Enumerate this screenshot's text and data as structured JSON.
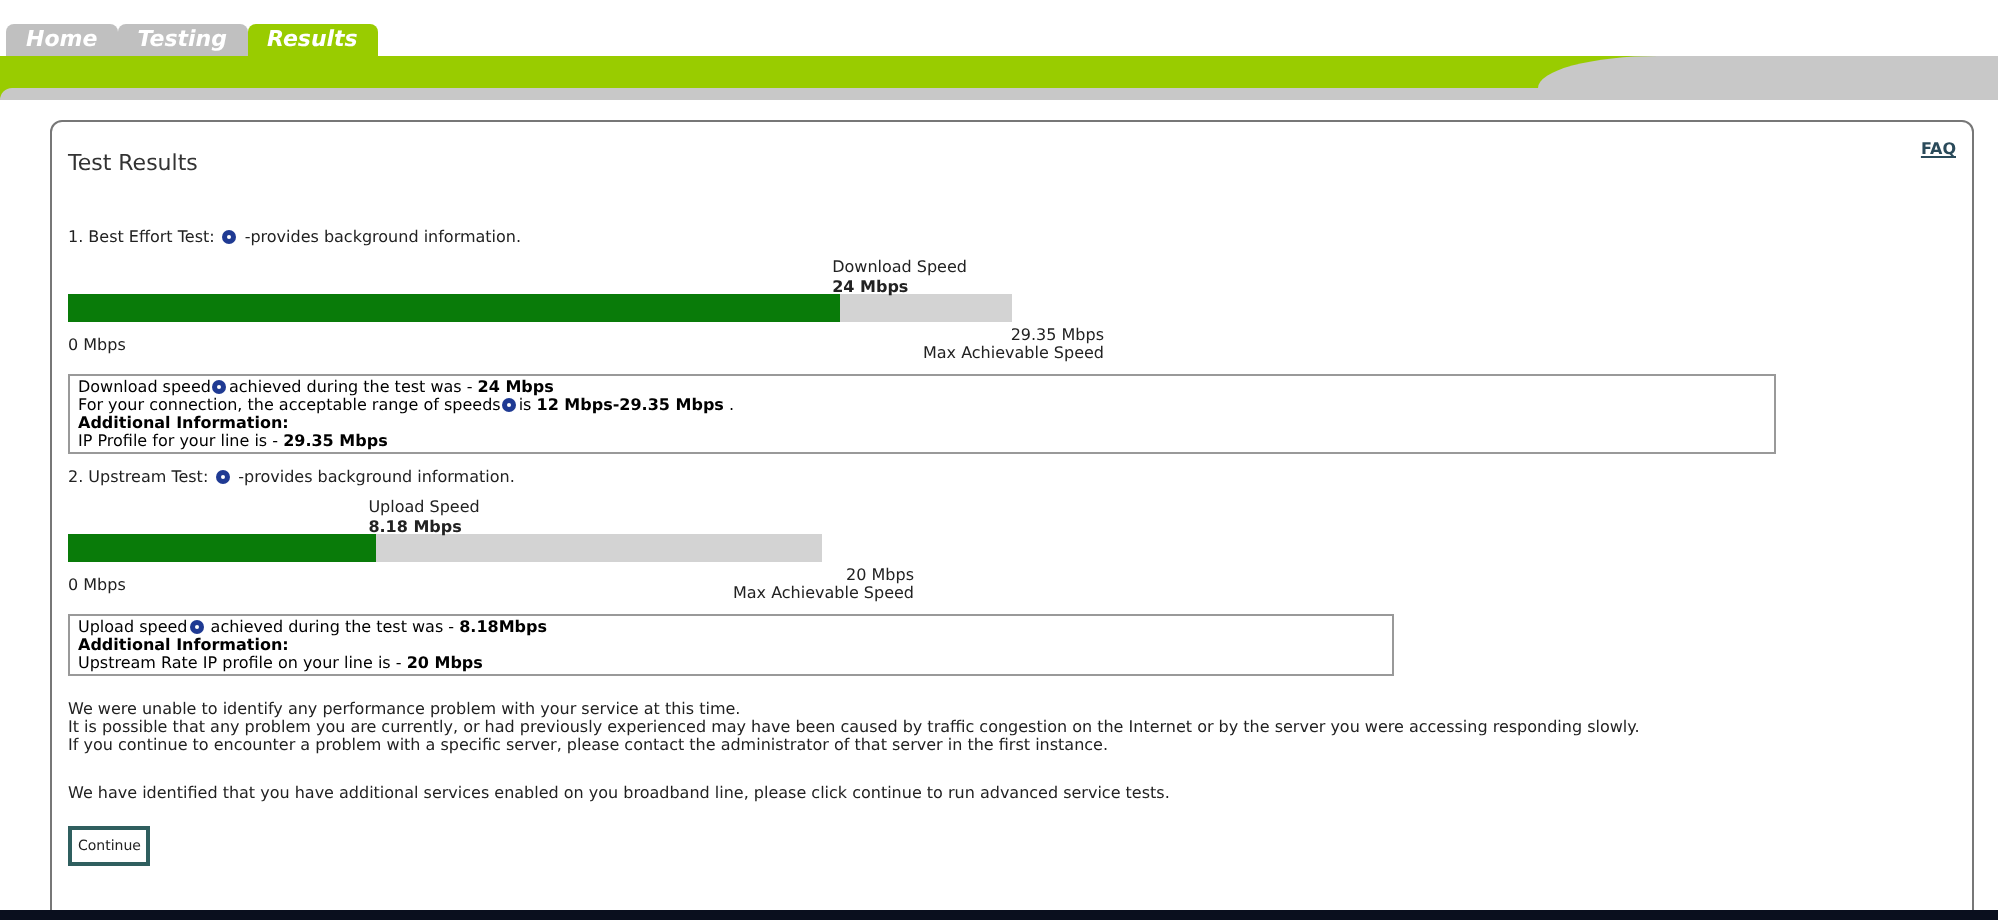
{
  "tabs": [
    {
      "label": "Home",
      "selected": false
    },
    {
      "label": "Testing",
      "selected": false
    },
    {
      "label": "Results",
      "selected": true
    }
  ],
  "panel": {
    "title": "Test Results",
    "faq": "FAQ"
  },
  "tests": [
    {
      "heading": [
        {
          "text": "1. Best Effort Test:"
        },
        {
          "kind": "help"
        },
        {
          "text": "-provides background information."
        }
      ],
      "speed_label": "Download Speed",
      "speed_value": "24 Mbps",
      "level": 0.818,
      "min_label": "0 Mbps",
      "max_value": "29.35 Mbps",
      "max_label": "Max Achievable Speed",
      "kind": "download",
      "info": [
        [
          {
            "text": "Download speed"
          },
          {
            "kind": "help"
          },
          {
            "text": "achieved during the test was - **24 Mbps**"
          }
        ],
        [
          {
            "text": "For your connection, the acceptable range of speeds"
          },
          {
            "kind": "help"
          },
          {
            "text": "is **12 Mbps-29.35 Mbps** ."
          }
        ],
        [
          {
            "text": "**Additional Information:**"
          }
        ],
        [
          {
            "text": "IP Profile for your line is - **29.35 Mbps**"
          }
        ]
      ]
    },
    {
      "heading": [
        {
          "text": "2. Upstream Test:"
        },
        {
          "kind": "help"
        },
        {
          "text": "-provides background information."
        }
      ],
      "speed_label": "Upload Speed",
      "speed_value": "8.18 Mbps",
      "level": 0.409,
      "min_label": "0 Mbps",
      "max_value": "20 Mbps",
      "max_label": "Max Achievable Speed",
      "kind": "upload",
      "info": [
        [
          {
            "text": "Upload speed"
          },
          {
            "kind": "help"
          },
          {
            "text": " achieved during the test was - **8.18Mbps**"
          }
        ],
        [
          {
            "text": "**Additional Information:**"
          }
        ],
        [
          {
            "text": "Upstream Rate IP profile on your line is - **20 Mbps**"
          }
        ]
      ]
    }
  ],
  "messages": [
    "We were unable to identify any performance problem with your service at this time.",
    "It is possible that any problem you are currently, or had previously experienced may have been caused by traffic congestion on the Internet or by the server you were accessing responding slowly.",
    "If you continue to encounter a problem with a specific server, please contact the administrator of that server in the first instance."
  ],
  "notice": "We have identified that you have additional services enabled on you broadband line, please click continue to run advanced service tests.",
  "button": "Continue"
}
